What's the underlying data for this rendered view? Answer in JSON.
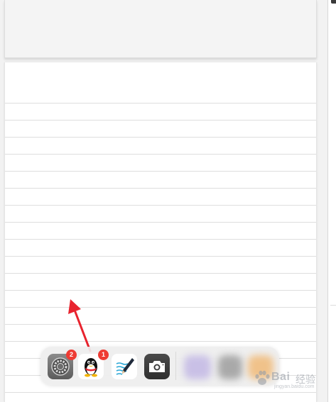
{
  "dock": {
    "apps": [
      {
        "name": "Settings",
        "icon": "settings-gear-icon",
        "badge": "2"
      },
      {
        "name": "QQ",
        "icon": "qq-penguin-icon",
        "badge": "1"
      },
      {
        "name": "Notes",
        "icon": "notes-pen-icon",
        "badge": ""
      },
      {
        "name": "Camera",
        "icon": "camera-icon",
        "badge": ""
      }
    ],
    "recent_apps": "blurred"
  },
  "annotation": {
    "type": "arrow",
    "color": "#e8232e"
  },
  "watermark": {
    "logo": "Bai",
    "text": "经验",
    "url": "jingyan.baidu.com"
  }
}
